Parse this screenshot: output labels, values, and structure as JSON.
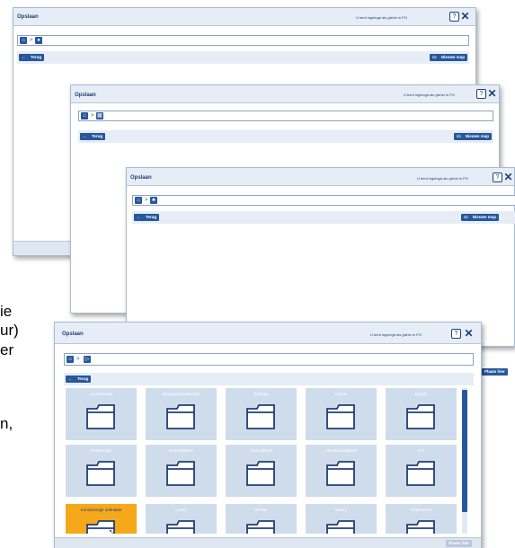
{
  "window_title": "Opslaan",
  "logged_in_text": "U bent ingelogd als gishin in PO",
  "help_label": "?",
  "close_label": "✕",
  "back_label": "Terug",
  "new_folder_label": "Nieuwe map",
  "place_label": "Plaats hier",
  "breadcrumb_separator": ">",
  "folders": [
    "Audiovisuele",
    "Bewegingsonderwijs",
    "Biologie",
    "Drama",
    "Engels",
    "Franse taal",
    "Geschiedenis",
    "Gezondheid",
    "Handvaardigheid",
    "ICT",
    "Kunstzinnige oriëntatie",
    "Lezen",
    "Muziek",
    "Natuur",
    "Nederlands"
  ],
  "selected_folder": "Kunstzinnige oriëntatie",
  "side_text": [
    "ie",
    "ur)",
    "er",
    "n,"
  ],
  "colors": {
    "accent": "#27579c",
    "titlebar": "#e6edf6",
    "tile": "#cfdceb",
    "selected": "#f4a81a"
  }
}
